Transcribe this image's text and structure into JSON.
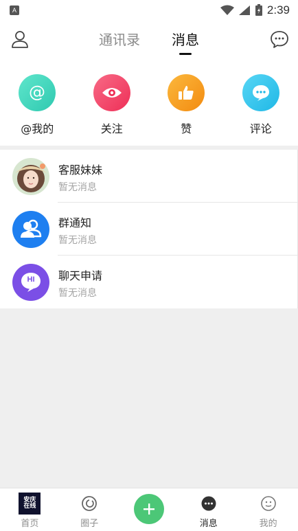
{
  "status_bar": {
    "time": "2:39",
    "app_glyph": "A"
  },
  "header": {
    "tabs": [
      {
        "label": "通讯录",
        "active": false
      },
      {
        "label": "消息",
        "active": true
      }
    ],
    "left_icon": "profile-icon",
    "right_icon": "chat-bubble-icon"
  },
  "quick_actions": [
    {
      "label": "@我的",
      "icon": "at-icon",
      "color": "#3fd8be"
    },
    {
      "label": "关注",
      "icon": "eye-icon",
      "color": "#f2496b"
    },
    {
      "label": "赞",
      "icon": "thumbs-up-icon",
      "color": "#f7a11c"
    },
    {
      "label": "评论",
      "icon": "comment-icon",
      "color": "#36c7ee"
    }
  ],
  "conversations": [
    {
      "title": "客服妹妹",
      "subtitle": "暂无消息",
      "avatar": "customer-service-avatar"
    },
    {
      "title": "群通知",
      "subtitle": "暂无消息",
      "avatar": "group-icon",
      "color": "#1e7ff0"
    },
    {
      "title": "聊天申请",
      "subtitle": "暂无消息",
      "avatar": "hi-bubble-icon",
      "color": "#7b4fe6",
      "avatar_text": "HI"
    }
  ],
  "bottom_nav": [
    {
      "label": "首页",
      "icon": "home-logo",
      "logo_text": "安庆在线",
      "active": false
    },
    {
      "label": "圈子",
      "icon": "circle-icon",
      "active": false
    },
    {
      "label": "",
      "icon": "plus-icon",
      "color": "#4cc777"
    },
    {
      "label": "消息",
      "icon": "message-icon",
      "active": true
    },
    {
      "label": "我的",
      "icon": "me-icon",
      "active": false
    }
  ]
}
